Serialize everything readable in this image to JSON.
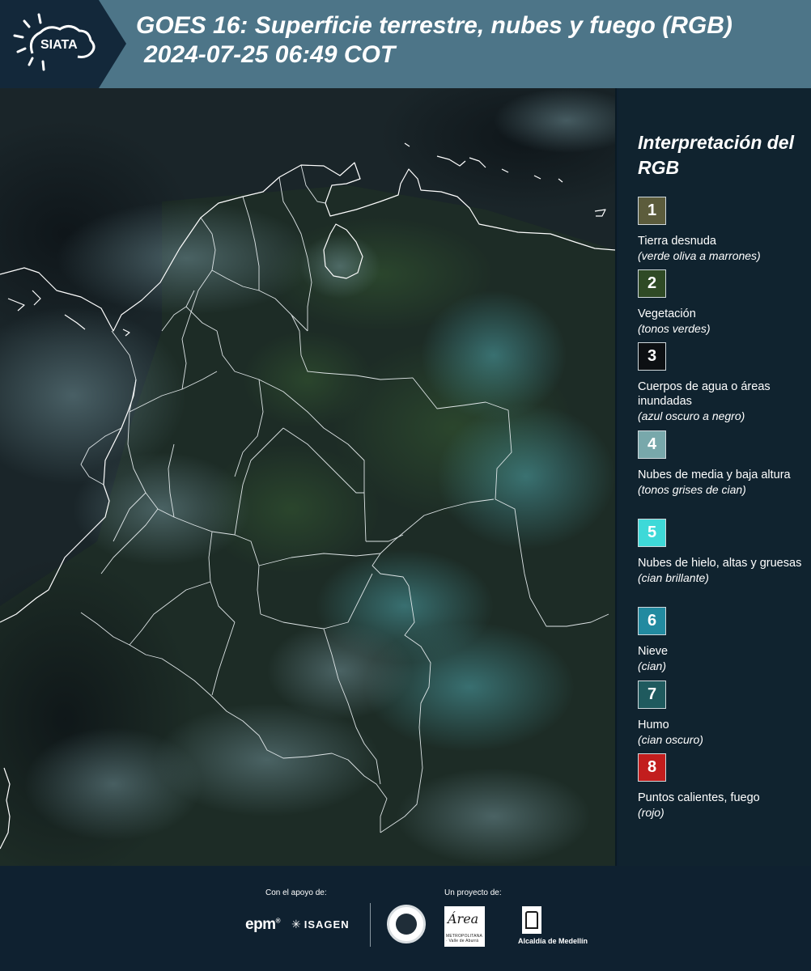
{
  "header": {
    "logo_text": "SIATA",
    "title_line1": "GOES 16: Superficie terrestre, nubes y fuego (RGB)",
    "title_line2": "2024-07-25 06:49 COT",
    "background_color": "#4d7588"
  },
  "legend": {
    "title": "Interpretación del RGB",
    "items": [
      {
        "number": "1",
        "label": "Tierra desnuda",
        "sub": "(verde oliva a marrones)",
        "color": "#5c5c3c"
      },
      {
        "number": "2",
        "label": "Vegetación",
        "sub": "(tonos verdes)",
        "color": "#2f4a25"
      },
      {
        "number": "3",
        "label": "Cuerpos de agua o áreas inundadas",
        "sub": "(azul oscuro a negro)",
        "color": "#0d1013"
      },
      {
        "number": "4",
        "label": "Nubes de media y baja altura",
        "sub": "(tonos grises de cian)",
        "color": "#78a8ab"
      },
      {
        "number": "5",
        "label": "Nubes de hielo, altas y gruesas",
        "sub": "(cian brillante)",
        "color": "#3ed9d8"
      },
      {
        "number": "6",
        "label": "Nieve",
        "sub": "(cian)",
        "color": "#228aa0"
      },
      {
        "number": "7",
        "label": "Humo",
        "sub": "(cian oscuro)",
        "color": "#1f5a5e"
      },
      {
        "number": "8",
        "label": "Puntos calientes, fuego",
        "sub": "(rojo)",
        "color": "#c21d1d"
      }
    ]
  },
  "footer": {
    "support_label": "Con el apoyo de:",
    "project_label": "Un proyecto de:",
    "epm_text": "epm",
    "isagen_text": "ISAGEN",
    "area_script": "Área",
    "area_small": "METROPOLITANA · Valle de Aburrá",
    "alcaldia_text": "Alcaldía de Medellín"
  }
}
